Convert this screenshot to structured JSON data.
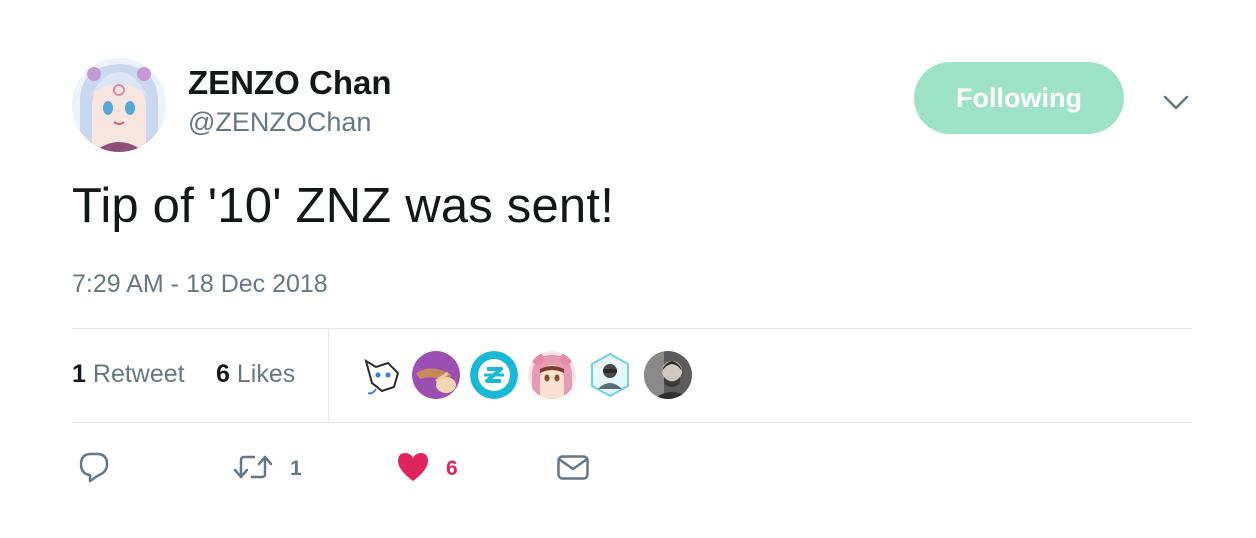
{
  "author": {
    "display_name": "ZENZO Chan",
    "handle": "@ZENZOChan"
  },
  "follow_button": {
    "label": "Following"
  },
  "tweet": {
    "text": "Tip of '10' ZNZ was sent!",
    "timestamp": "7:29 AM - 18 Dec 2018"
  },
  "stats": {
    "retweet_count": "1",
    "retweet_label": "Retweet",
    "like_count": "6",
    "like_label": "Likes"
  },
  "liked_by": [
    {
      "name": "liker-1"
    },
    {
      "name": "liker-2"
    },
    {
      "name": "liker-3"
    },
    {
      "name": "liker-4"
    },
    {
      "name": "liker-5"
    },
    {
      "name": "liker-6"
    }
  ],
  "actions": {
    "reply_icon": "reply-icon",
    "retweet_icon": "retweet-icon",
    "retweet_count": "1",
    "like_icon": "heart-icon",
    "like_count": "6",
    "dm_icon": "envelope-icon"
  },
  "colors": {
    "follow_button_bg": "#9ee3c7",
    "like_red": "#e0245e",
    "secondary_text": "#657786"
  }
}
